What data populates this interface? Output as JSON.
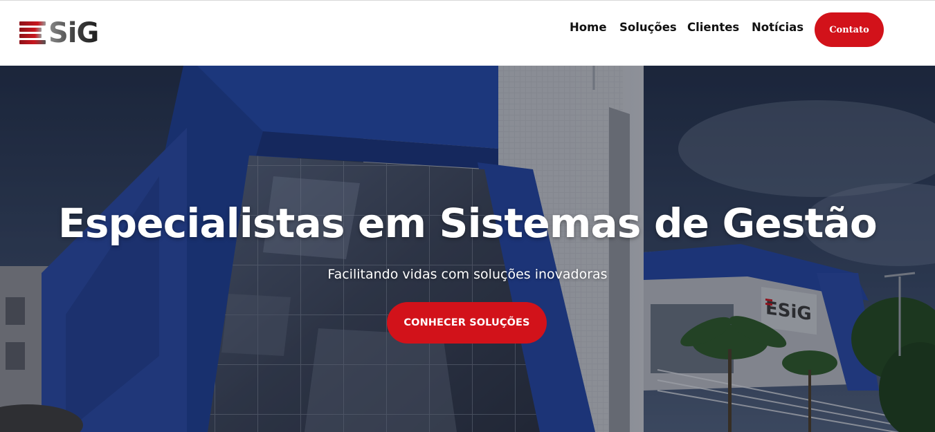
{
  "header": {
    "logo_text": "SiG",
    "nav": [
      {
        "label": "Home"
      },
      {
        "label": "Soluções"
      },
      {
        "label": "Clientes"
      },
      {
        "label": "Notícias"
      }
    ],
    "contact_label": "Contato"
  },
  "hero": {
    "title": "Especialistas em Sistemas de Gestão",
    "subtitle": "Facilitando vidas com soluções inovadoras",
    "cta_label": "CONHECER SOLUÇÕES",
    "building_sign": "ESiG"
  },
  "colors": {
    "accent": "#d2121a",
    "nav_text": "#111111",
    "header_bg": "#ffffff",
    "building_blue": "#23459a"
  }
}
